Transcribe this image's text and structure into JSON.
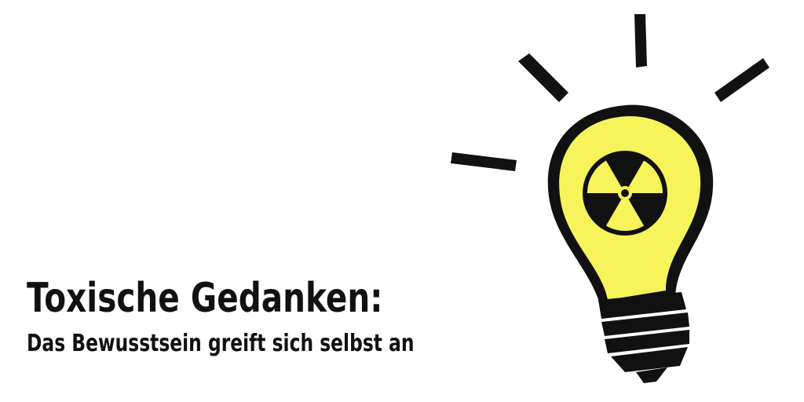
{
  "header": {
    "title": "Toxische Gedanken:",
    "subtitle": "Das Bewusstsein greift sich selbst an"
  },
  "illustration": {
    "icon": "radioactive-lightbulb-icon",
    "colors": {
      "bulb_fill": "#f6f45a",
      "outline": "#111111",
      "background": "#ffffff"
    }
  }
}
